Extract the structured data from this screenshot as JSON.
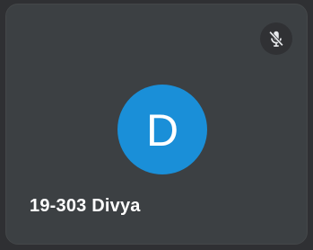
{
  "tile": {
    "participant_name": "19-303 Divya",
    "avatar_initial": "D",
    "avatar_color": "#1a8fd8",
    "background_color": "#3c4043",
    "mic_status_icon": "mic-off-icon"
  }
}
